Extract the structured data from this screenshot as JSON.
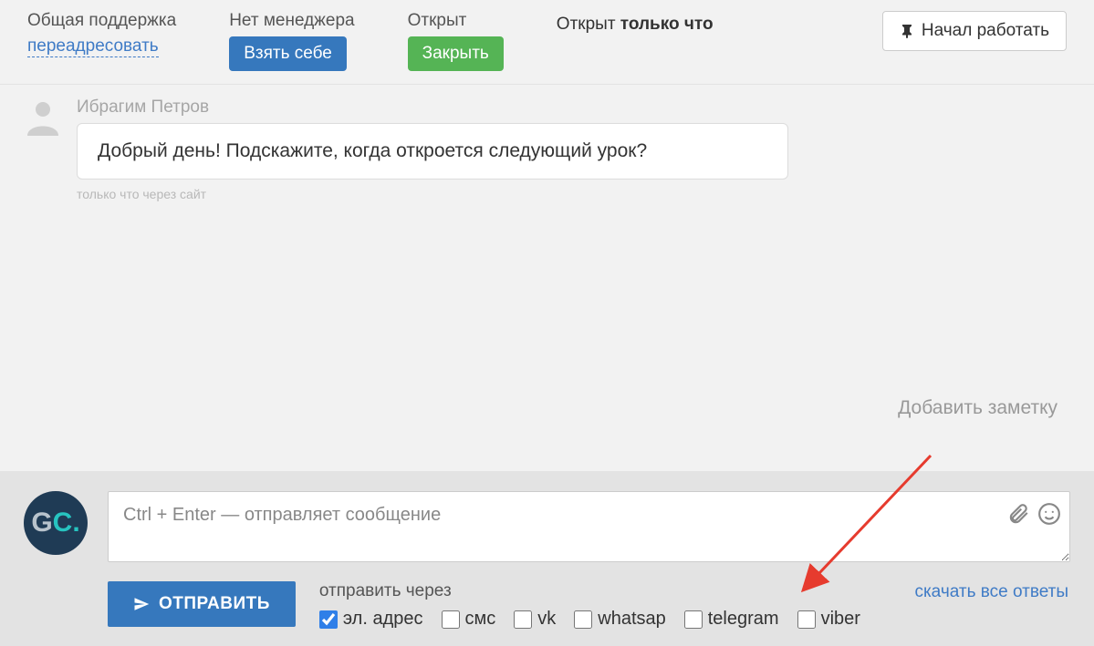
{
  "topbar": {
    "support": {
      "label": "Общая поддержка",
      "link": "переадресовать"
    },
    "manager": {
      "label": "Нет менеджера",
      "button": "Взять себе"
    },
    "open": {
      "label": "Открыт",
      "button": "Закрыть"
    },
    "status": {
      "prefix": "Открыт ",
      "bold": "только что"
    },
    "start_work": "Начал работать"
  },
  "conversation": {
    "sender": "Ибрагим Петров",
    "message": "Добрый день! Подскажите, когда откроется следующий урок?",
    "meta": "только что через сайт"
  },
  "add_note": "Добавить заметку",
  "compose": {
    "placeholder": "Ctrl + Enter — отправляет сообщение",
    "send_button": "ОТПРАВИТЬ",
    "send_via_label": "отправить через",
    "channels": {
      "email": {
        "label": "эл. адрес",
        "checked": true
      },
      "sms": {
        "label": "смс",
        "checked": false
      },
      "vk": {
        "label": "vk",
        "checked": false
      },
      "whatsapp": {
        "label": "whatsap",
        "checked": false
      },
      "telegram": {
        "label": "telegram",
        "checked": false
      },
      "viber": {
        "label": "viber",
        "checked": false
      }
    },
    "download_all": "скачать все ответы",
    "avatar_text": {
      "g": "G",
      "c": "C",
      "dot": "."
    }
  }
}
